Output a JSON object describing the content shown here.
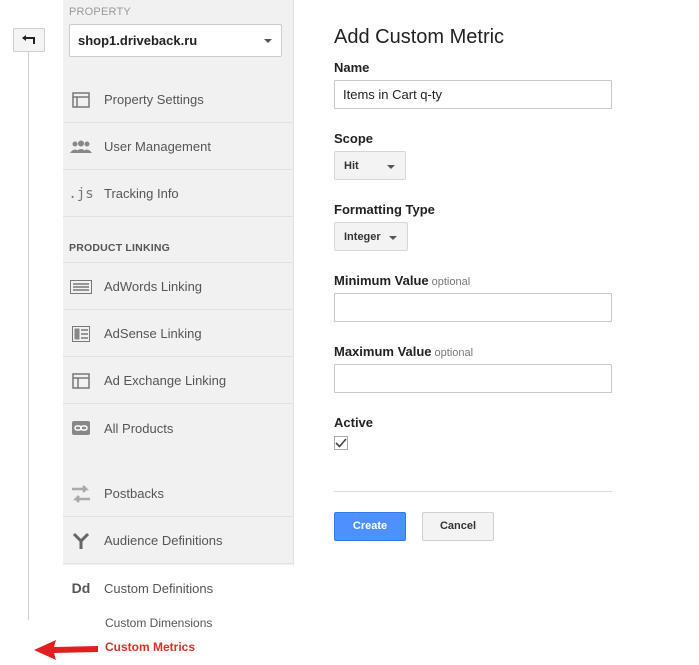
{
  "nav": {
    "property_label": "PROPERTY",
    "property_value": "shop1.driveback.ru",
    "items": [
      {
        "label": "Property Settings",
        "icon": "property-settings-icon"
      },
      {
        "label": "User Management",
        "icon": "users-icon"
      },
      {
        "label": "Tracking Info",
        "icon": "js-icon"
      }
    ],
    "product_linking_header": "PRODUCT LINKING",
    "linking_items": [
      {
        "label": "AdWords Linking",
        "icon": "adwords-icon"
      },
      {
        "label": "AdSense Linking",
        "icon": "adsense-icon"
      },
      {
        "label": "Ad Exchange Linking",
        "icon": "ad-exchange-icon"
      },
      {
        "label": "All Products",
        "icon": "link-icon"
      }
    ],
    "lower_items": [
      {
        "label": "Postbacks",
        "icon": "postbacks-icon"
      },
      {
        "label": "Audience Definitions",
        "icon": "audience-icon"
      },
      {
        "label": "Custom Definitions",
        "icon": "dd-icon",
        "icon_text": "Dd"
      }
    ],
    "sub_items": [
      {
        "label": "Custom Dimensions"
      },
      {
        "label": "Custom Metrics"
      }
    ]
  },
  "form": {
    "title": "Add Custom Metric",
    "name_label": "Name",
    "name_value": "Items in Cart q-ty",
    "scope_label": "Scope",
    "scope_value": "Hit",
    "formatting_label": "Formatting Type",
    "formatting_value": "Integer",
    "min_label": "Minimum Value",
    "max_label": "Maximum Value",
    "optional_text": "optional",
    "active_label": "Active",
    "active_checked": true,
    "create_label": "Create",
    "cancel_label": "Cancel"
  },
  "colors": {
    "accent": "#4d90fe",
    "highlight": "#d93025"
  }
}
